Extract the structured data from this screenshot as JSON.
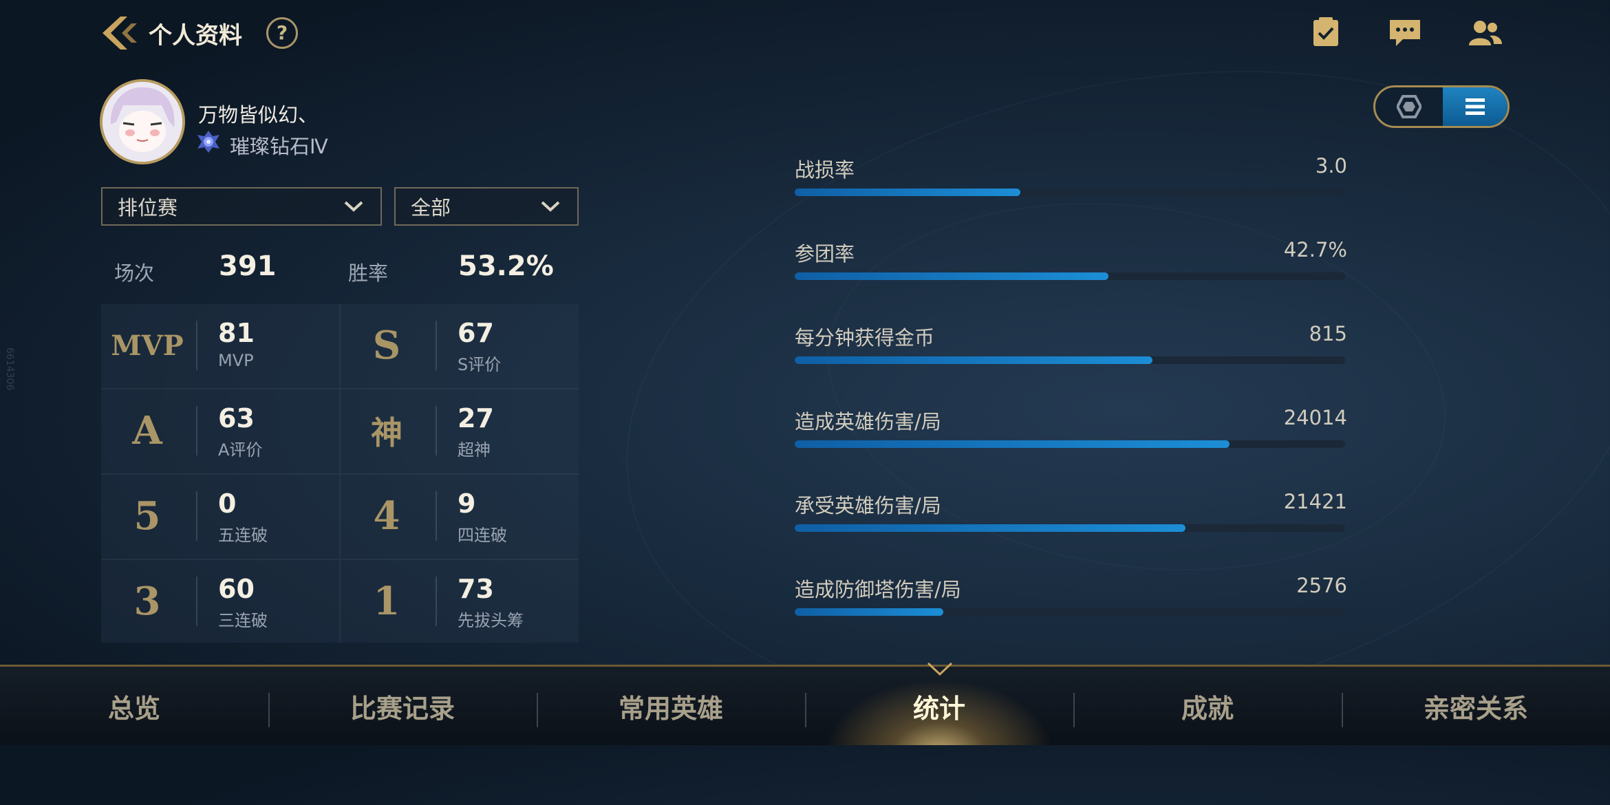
{
  "header": {
    "title": "个人资料",
    "help": "?"
  },
  "profile": {
    "username": "万物皆似幻、",
    "rank": "璀璨钻石Ⅳ"
  },
  "filters": {
    "mode": "排位赛",
    "scope": "全部"
  },
  "summary": {
    "games_label": "场次",
    "games_value": "391",
    "winrate_label": "胜率",
    "winrate_value": "53.2%"
  },
  "grid": [
    {
      "badge": "MVP",
      "num": "81",
      "label": "MVP"
    },
    {
      "badge": "S",
      "num": "67",
      "label": "S评价"
    },
    {
      "badge": "A",
      "num": "63",
      "label": "A评价"
    },
    {
      "badge": "神",
      "num": "27",
      "label": "超神"
    },
    {
      "badge": "5",
      "num": "0",
      "label": "五连破"
    },
    {
      "badge": "4",
      "num": "9",
      "label": "四连破"
    },
    {
      "badge": "3",
      "num": "60",
      "label": "三连破"
    },
    {
      "badge": "1",
      "num": "73",
      "label": "先拔头筹"
    }
  ],
  "stats": [
    {
      "name": "战损率",
      "value": "3.0",
      "fill": 0.41
    },
    {
      "name": "参团率",
      "value": "42.7%",
      "fill": 0.57
    },
    {
      "name": "每分钟获得金币",
      "value": "815",
      "fill": 0.65
    },
    {
      "name": "造成英雄伤害/局",
      "value": "24014",
      "fill": 0.79
    },
    {
      "name": "承受英雄伤害/局",
      "value": "21421",
      "fill": 0.71
    },
    {
      "name": "造成防御塔伤害/局",
      "value": "2576",
      "fill": 0.27
    }
  ],
  "nav": {
    "tabs": [
      "总览",
      "比赛记录",
      "常用英雄",
      "统计",
      "成就",
      "亲密关系"
    ],
    "active_index": 3
  },
  "side_id": "6614306",
  "icons": [
    "back-icon",
    "help-icon",
    "task-icon",
    "chat-icon",
    "friends-icon",
    "rank-diamond-icon",
    "hexagon-view-icon",
    "list-view-icon",
    "chevron-down-icon"
  ],
  "colors": {
    "accent_gold": "#b79c60",
    "bar_blue": "#1c8ed6",
    "background": "#182a3d"
  }
}
